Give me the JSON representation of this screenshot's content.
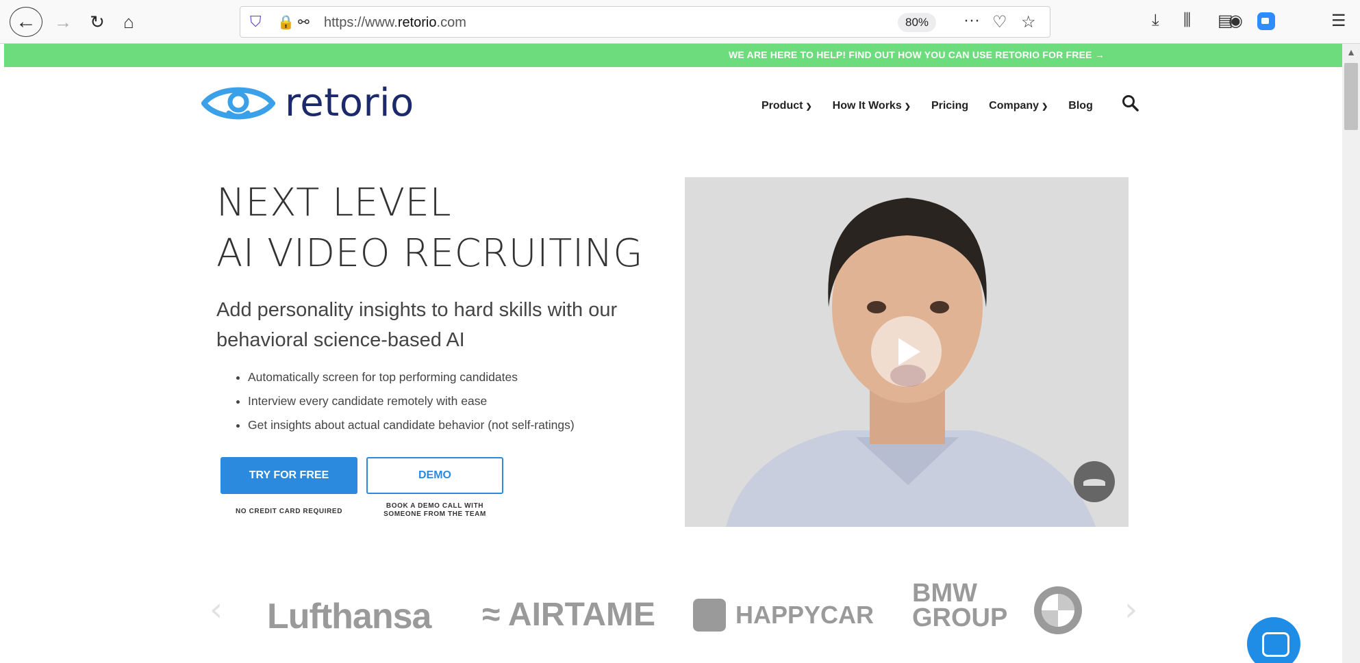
{
  "browser": {
    "url_prefix": "https://www.",
    "url_domain": "retorio",
    "url_suffix": ".com",
    "zoom": "80%"
  },
  "banner": {
    "text": "WE ARE HERE TO HELP! FIND OUT HOW YOU CAN USE RETORIO FOR FREE →"
  },
  "site": {
    "logo_text": "retorio",
    "nav": [
      {
        "label": "Product",
        "has_dropdown": true
      },
      {
        "label": "How It Works",
        "has_dropdown": true
      },
      {
        "label": "Pricing",
        "has_dropdown": false
      },
      {
        "label": "Company",
        "has_dropdown": true
      },
      {
        "label": "Blog",
        "has_dropdown": false
      }
    ]
  },
  "hero": {
    "title_line1": "NEXT LEVEL",
    "title_line2": "AI VIDEO RECRUITING",
    "subtitle": "Add personality insights to hard skills with our behavioral science-based AI",
    "bullets": [
      "Automatically screen for top performing candidates",
      "Interview every candidate remotely with ease",
      "Get insights about actual candidate behavior (not self-ratings)"
    ],
    "try_button": "TRY FOR FREE",
    "try_note": "NO CREDIT CARD REQUIRED",
    "demo_button": "DEMO",
    "demo_note": "BOOK A DEMO CALL WITH SOMEONE FROM THE TEAM"
  },
  "clients": {
    "lufthansa": "Lufthansa",
    "airtame": "AIRTAME",
    "happycar": "HAPPYCAR",
    "bmw_line1": "BMW",
    "bmw_line2": "GROUP"
  },
  "colors": {
    "banner_green": "#6ddc7c",
    "brand_blue": "#2b8ade",
    "logo_navy": "#1c2a6b",
    "chat_blue": "#1f8ce6"
  }
}
